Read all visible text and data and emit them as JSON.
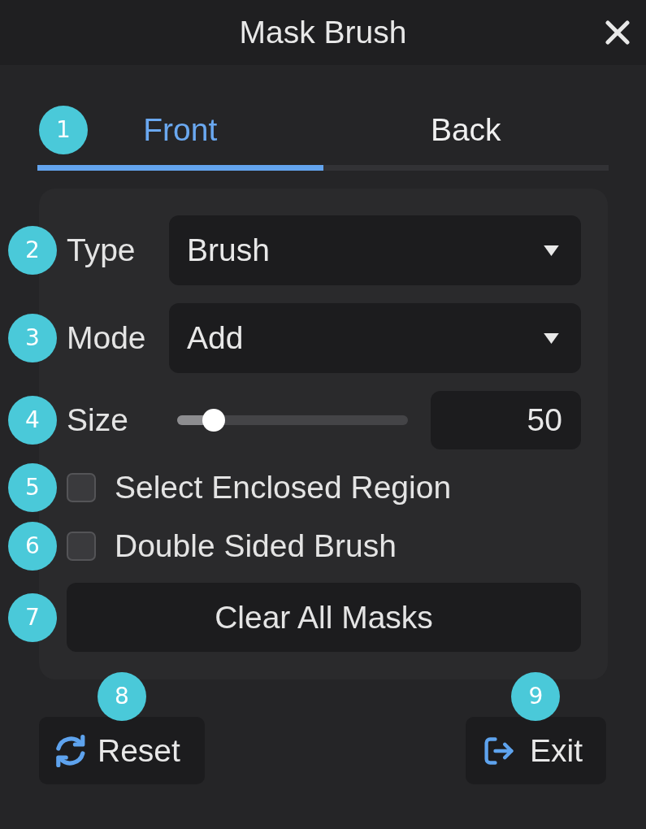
{
  "window": {
    "title": "Mask Brush"
  },
  "tabs": {
    "callout": "1",
    "items": [
      {
        "label": "Front",
        "selected": true
      },
      {
        "label": "Back",
        "selected": false
      }
    ]
  },
  "settings": [
    {
      "kind": "dropdown",
      "callout": "2",
      "label": "Type",
      "value": "Brush"
    },
    {
      "kind": "dropdown",
      "callout": "3",
      "label": "Mode",
      "value": "Add"
    },
    {
      "kind": "slider",
      "callout": "4",
      "label": "Size",
      "level": 0.16,
      "value": "50"
    },
    {
      "kind": "checkbox",
      "callout": "5",
      "label": "Select Enclosed Region",
      "checked": false
    },
    {
      "kind": "checkbox",
      "callout": "6",
      "label": "Double Sided Brush",
      "checked": false
    },
    {
      "kind": "button",
      "callout": "7",
      "label": "Clear All Masks"
    }
  ],
  "footer": [
    {
      "kind": "reset",
      "callout": "8",
      "label": "Reset"
    },
    {
      "kind": "exit",
      "callout": "9",
      "label": "Exit"
    }
  ]
}
